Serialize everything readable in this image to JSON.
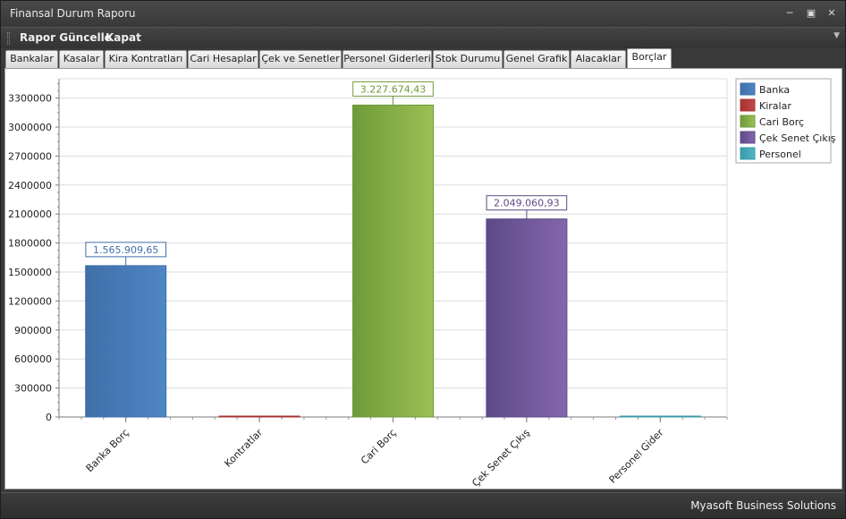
{
  "window": {
    "title": "Finansal Durum Raporu"
  },
  "menu": {
    "items": [
      "Rapor Güncelle",
      "Kapat"
    ]
  },
  "tabs": [
    "Bankalar",
    "Kasalar",
    "Kira Kontratları",
    "Cari Hesaplar",
    "Çek ve Senetler",
    "Personel Giderleri",
    "Stok Durumu",
    "Genel Grafik",
    "Alacaklar",
    "Borçlar"
  ],
  "active_tab": "Borçlar",
  "status": {
    "brand": "Myasoft Business Solutions"
  },
  "chart_data": {
    "type": "bar",
    "title": "",
    "xlabel": "",
    "ylabel": "",
    "ylim": [
      0,
      3500000
    ],
    "yticks": [
      0,
      300000,
      600000,
      900000,
      1200000,
      1500000,
      1800000,
      2100000,
      2400000,
      2700000,
      3000000,
      3300000
    ],
    "grid": true,
    "legend_position": "top-right",
    "categories": [
      "Banka Borç",
      "Kontratlar",
      "Cari Borç",
      "Çek Senet Çıkış",
      "Personel Gider"
    ],
    "series": [
      {
        "name": "Banka",
        "values": [
          1565909.65,
          0,
          0,
          0,
          0
        ],
        "label": "1.565.909,65",
        "color": "#3f6fa8",
        "light": "#4f86c6"
      },
      {
        "name": "Kiralar",
        "values": [
          0,
          0,
          0,
          0,
          0
        ],
        "label": "",
        "color": "#a83232",
        "light": "#c24848"
      },
      {
        "name": "Cari Borç",
        "values": [
          0,
          0,
          3227674.43,
          0,
          0
        ],
        "label": "3.227.674,43",
        "color": "#6f9a3a",
        "light": "#9bc154"
      },
      {
        "name": "Çek Senet Çıkış",
        "values": [
          0,
          0,
          0,
          2049060.93,
          0
        ],
        "label": "2.049.060,93",
        "color": "#5d4a88",
        "light": "#8466ab"
      },
      {
        "name": "Personel",
        "values": [
          0,
          0,
          0,
          0,
          0
        ],
        "label": "",
        "color": "#3b9aa8",
        "light": "#4fb7c6"
      }
    ]
  }
}
